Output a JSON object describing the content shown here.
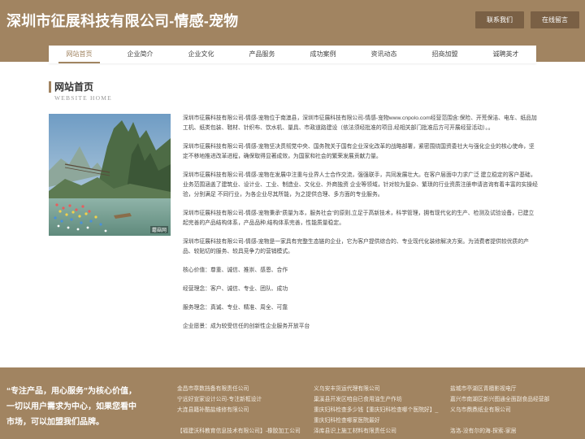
{
  "header": {
    "title": "深圳市征展科技有限公司-情感-宠物",
    "contact_button": "联系我们",
    "message_button": "在线留言"
  },
  "nav": {
    "items": [
      "网站首页",
      "企业简介",
      "企业文化",
      "产品服务",
      "成功案例",
      "资讯动态",
      "招商加盟",
      "诚聘英才"
    ],
    "active_index": 0
  },
  "section": {
    "title": "网站首页",
    "subtitle": "WEBSITE HOME"
  },
  "photo": {
    "watermark": "蘑菇网"
  },
  "content": {
    "paragraphs": [
      "深圳市征展科技有限公司-情感-宠物位于南澳县，深圳市征展科技有限公司-情感-宠物www.cnpolo.com经营范围含:保险、开荒保洁、电车、纸品加工机、纸类包装、鞋材、针织布、饮水机、量具、市政道路建设（依法须经批准的项目,经相关部门批准后方可开展经营活动）。。",
      "深圳市征展科技有限公司-情感-宠物坚决贯彻党中央、国务院关于国有企业深化改革的战略部署，紧密围绕国资委社大与强化企业的核心使命，坚定不移地推进改革进程，确保取得显著成效，为国家和社会的繁荣发展贡献力量。",
      "深圳市征展科技有限公司-情感-宠物在发展中注重与业界人士合作交流，强强联手，共同发展壮大。在客户层面中力求广泛 建立稳定的客户基础，业务范围涵盖了建筑业、设计业、工业、制造业、文化业、外商独资 企业等领域，针对较为复杂、繁琐的行业资质注册申请咨询有着丰富的实操经验，分别满足 不同行业，为各企业尽其所能，为之提供合理、多方面的专业服务。",
      "深圳市征展科技有限公司-情感-宠物秉承“质量为本，服务社会”的原则,立足于高新技术，科学管理，拥有现代化的生产、检测及试验设备，已建立起完善的产品结构体系，产品品种,结构体系完善，性能质量稳定。",
      "深圳市征展科技有限公司-情感-宠物是一家具有完整生态链的企业，它为客户提供综合的、专业现代化装修解决方案。为消费者提供较优质的产品、较贴切的服务、较具竞争力的营销模式。",
      "核心价值：尊重、诚信、推崇、感恩、合作",
      "经营理念：客户、诚信、专业、团队、成功",
      "服务理念：真诚、专业、精准、周全、可靠",
      "企业愿景：成为较受信任的创新性企业服务开放平台"
    ]
  },
  "footer": {
    "slogan": "“专注产品，用心服务”为核心价值，一切以用户需求为中心，如果您看中市场，可以加盟我们品牌。",
    "links_col1": [
      "金昌市章数挡备有限责任公司",
      "宁远好宣家设计公司-专注新框设计",
      "大连县籍补酷盐维修有限公司",
      "",
      "【福建沃科教育信息技术有限公司】-橡胶加工公司"
    ],
    "links_col2": [
      "义乌安丰货运代理有限公司",
      "巢溪县开发区咱自已食用油生产作坊",
      "重庆妇科检查多少钱【重庆妇科检查哪个医院好】_",
      "重庆妇科检查哪家医院最好",
      "泽库县识上施工材料有限责任公司"
    ],
    "links_col3": [
      "盐城市亭湖区青檀影视电厅",
      "嘉兴市南湖区新兴图通全面副食品经营部",
      "义乌市鼎鼎纸业有限公司",
      "",
      "洛洛-没有尔的海-探索-家居"
    ]
  },
  "colors": {
    "brand": "#a18461",
    "brand_dark": "#7a6045"
  }
}
